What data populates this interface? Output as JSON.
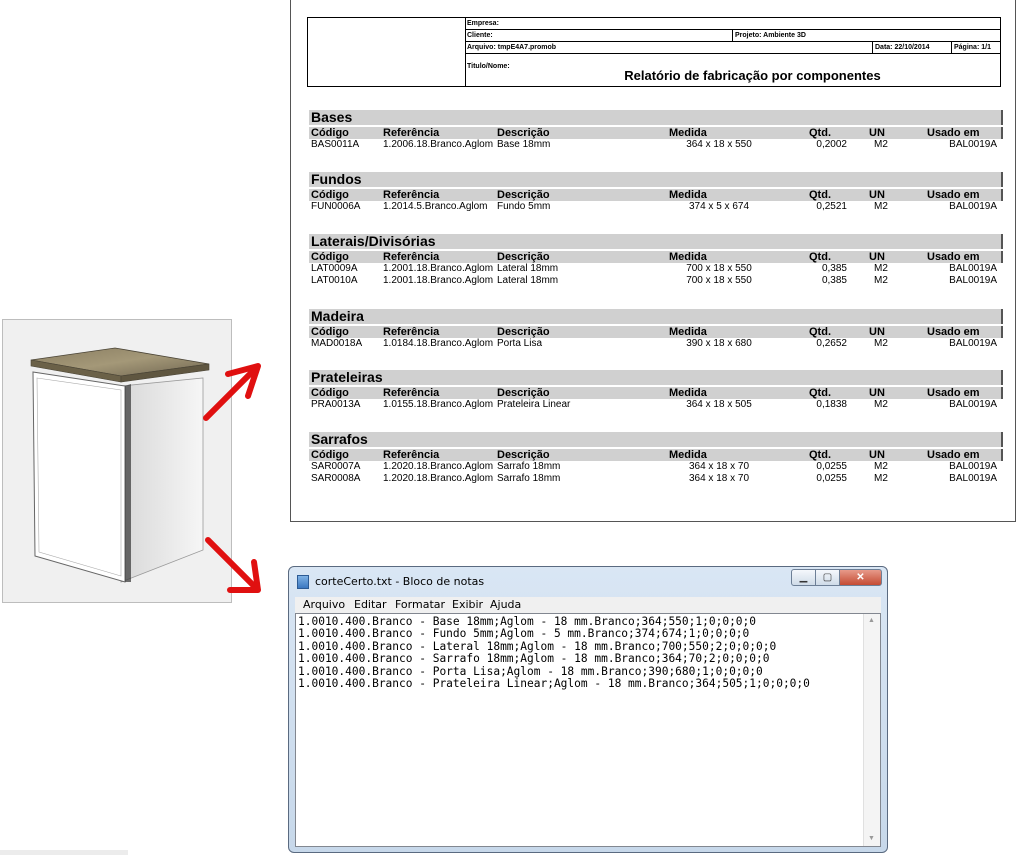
{
  "colors": {
    "arrow": "#e01010",
    "section_bar": "#d0d0d0"
  },
  "report": {
    "header": {
      "empresa_label": "Empresa:",
      "cliente_label": "Cliente:",
      "projeto_label": "Projeto:",
      "projeto_value": "Ambiente 3D",
      "arquivo_label": "Arquivo:",
      "arquivo_value": "tmpE4A7.promob",
      "data_label": "Data:",
      "data_value": "22/10/2014",
      "pagina_label": "Página:",
      "pagina_value": "1/1",
      "titulo_label": "Titulo/Nome:",
      "title": "Relatório de fabricação por componentes"
    },
    "columns": [
      "Código",
      "Referência",
      "Descrição",
      "Medida",
      "Qtd.",
      "UN",
      "Usado em"
    ],
    "sections": [
      {
        "name": "Bases",
        "rows": [
          {
            "codigo": "BAS0011A",
            "referencia": "1.2006.18.Branco.Aglom",
            "descricao": "Base 18mm",
            "medida": "364 x 18 x 550",
            "qtd": "0,2002",
            "un": "M2",
            "usado": "BAL0019A"
          }
        ]
      },
      {
        "name": "Fundos",
        "rows": [
          {
            "codigo": "FUN0006A",
            "referencia": "1.2014.5.Branco.Aglom",
            "descricao": "Fundo 5mm",
            "medida": "374 x 5 x 674",
            "qtd": "0,2521",
            "un": "M2",
            "usado": "BAL0019A"
          }
        ]
      },
      {
        "name": "Laterais/Divisórias",
        "rows": [
          {
            "codigo": "LAT0009A",
            "referencia": "1.2001.18.Branco.Aglom",
            "descricao": "Lateral 18mm",
            "medida": "700 x 18 x 550",
            "qtd": "0,385",
            "un": "M2",
            "usado": "BAL0019A"
          },
          {
            "codigo": "LAT0010A",
            "referencia": "1.2001.18.Branco.Aglom",
            "descricao": "Lateral 18mm",
            "medida": "700 x 18 x 550",
            "qtd": "0,385",
            "un": "M2",
            "usado": "BAL0019A"
          }
        ]
      },
      {
        "name": "Madeira",
        "rows": [
          {
            "codigo": "MAD0018A",
            "referencia": "1.0184.18.Branco.Aglom",
            "descricao": "Porta Lisa",
            "medida": "390 x 18 x 680",
            "qtd": "0,2652",
            "un": "M2",
            "usado": "BAL0019A"
          }
        ]
      },
      {
        "name": "Prateleiras",
        "rows": [
          {
            "codigo": "PRA0013A",
            "referencia": "1.0155.18.Branco.Aglom",
            "descricao": "Prateleira Linear",
            "medida": "364 x 18 x 505",
            "qtd": "0,1838",
            "un": "M2",
            "usado": "BAL0019A"
          }
        ]
      },
      {
        "name": "Sarrafos",
        "rows": [
          {
            "codigo": "SAR0007A",
            "referencia": "1.2020.18.Branco.Aglom",
            "descricao": "Sarrafo 18mm",
            "medida": "364 x 18 x 70",
            "qtd": "0,0255",
            "un": "M2",
            "usado": "BAL0019A"
          },
          {
            "codigo": "SAR0008A",
            "referencia": "1.2020.18.Branco.Aglom",
            "descricao": "Sarrafo 18mm",
            "medida": "364 x 18 x 70",
            "qtd": "0,0255",
            "un": "M2",
            "usado": "BAL0019A"
          }
        ]
      }
    ]
  },
  "notepad": {
    "title": "corteCerto.txt - Bloco de notas",
    "icon": "notepad-icon",
    "menu": [
      "Arquivo",
      "Editar",
      "Formatar",
      "Exibir",
      "Ajuda"
    ],
    "lines": [
      "1.0010.400.Branco - Base 18mm;Aglom - 18 mm.Branco;364;550;1;0;0;0;0",
      "1.0010.400.Branco - Fundo 5mm;Aglom - 5 mm.Branco;374;674;1;0;0;0;0",
      "1.0010.400.Branco - Lateral 18mm;Aglom - 18 mm.Branco;700;550;2;0;0;0;0",
      "1.0010.400.Branco - Sarrafo 18mm;Aglom - 18 mm.Branco;364;70;2;0;0;0;0",
      "1.0010.400.Branco - Porta Lisa;Aglom - 18 mm.Branco;390;680;1;0;0;0;0",
      "1.0010.400.Branco - Prateleira Linear;Aglom - 18 mm.Branco;364;505;1;0;0;0;0"
    ]
  }
}
